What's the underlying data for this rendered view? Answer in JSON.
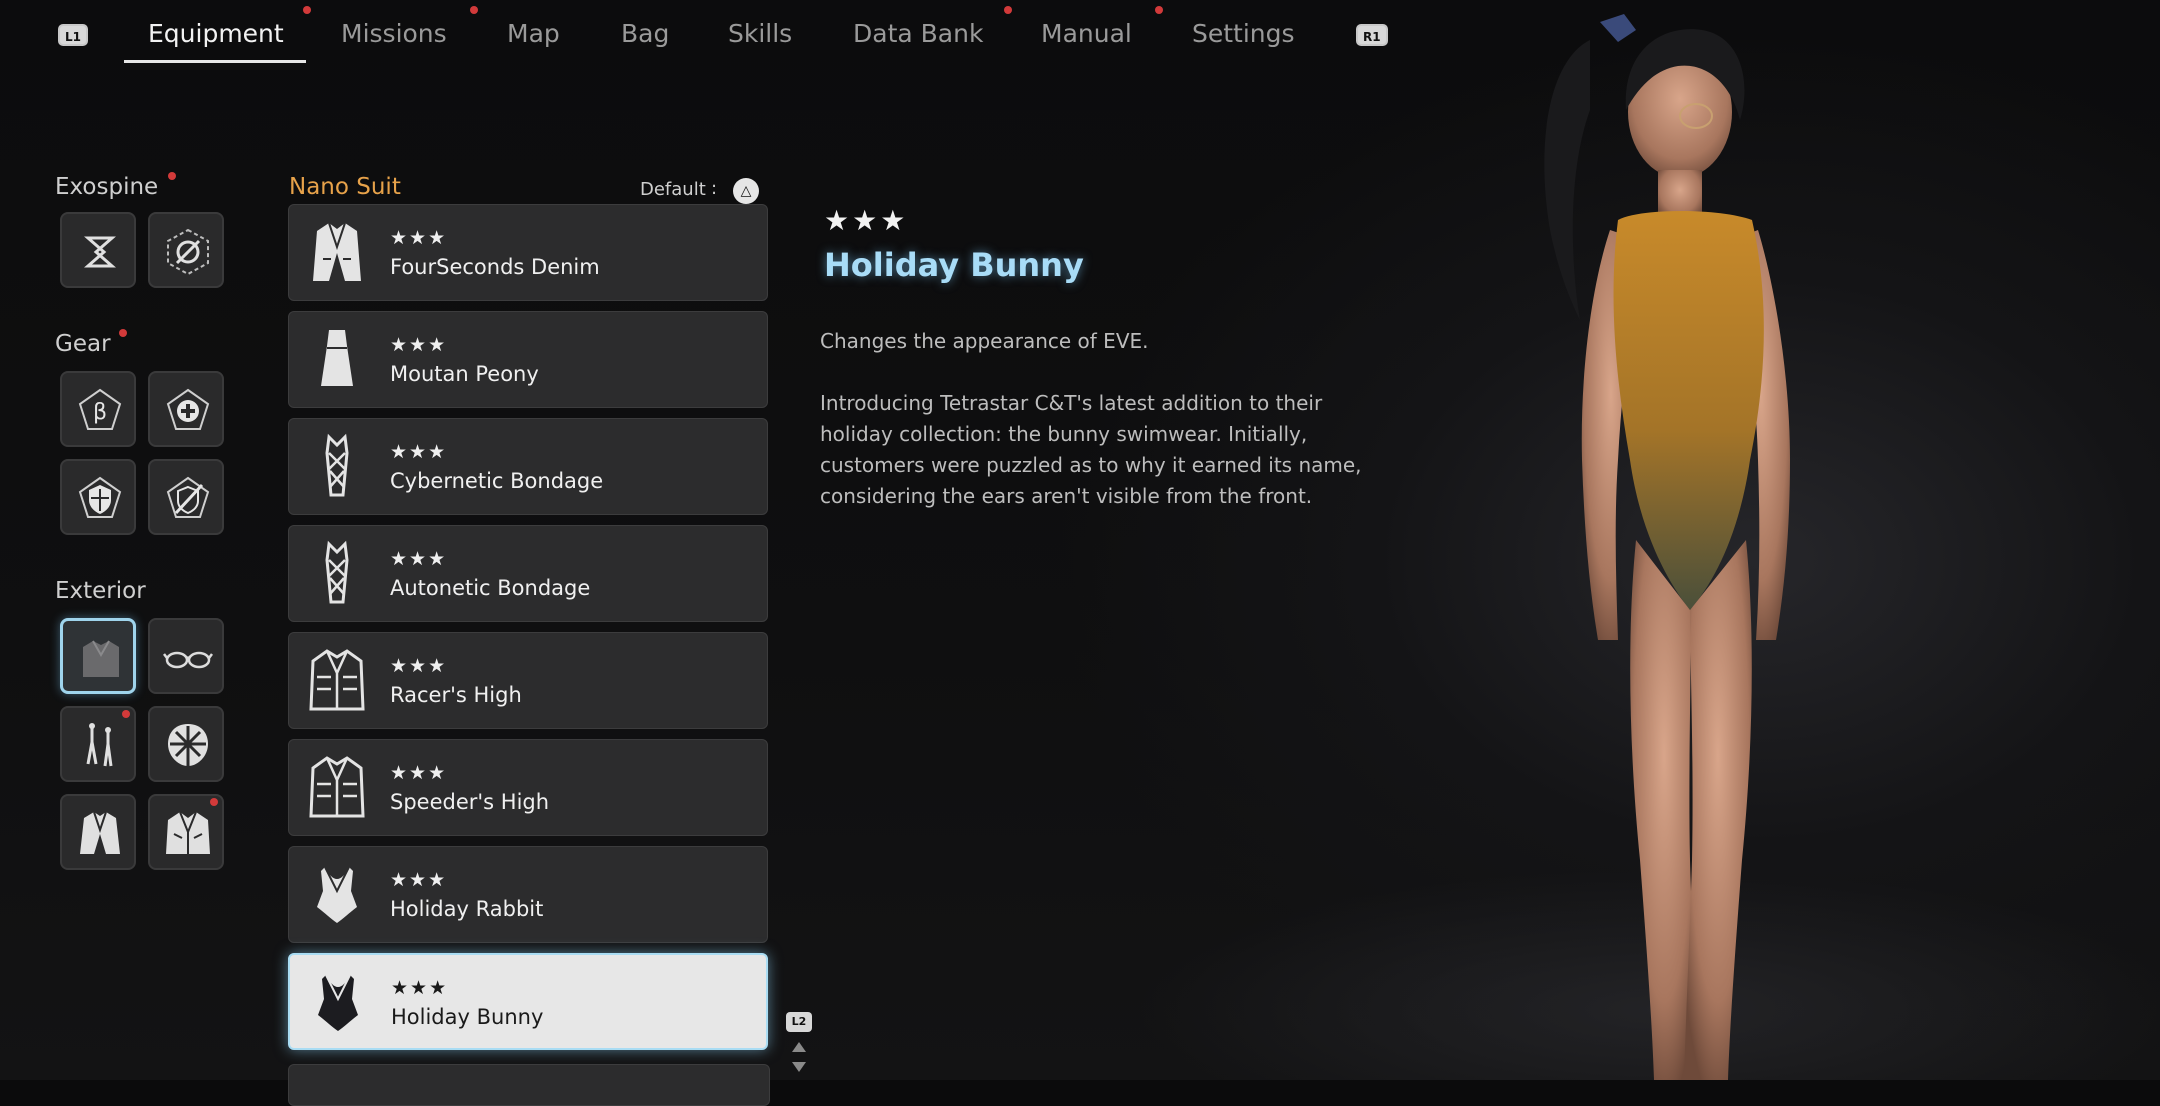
{
  "nav": {
    "left_button": "L1",
    "right_button": "R1",
    "tabs": [
      {
        "label": "Equipment",
        "active": true,
        "notify": true
      },
      {
        "label": "Missions",
        "active": false,
        "notify": true
      },
      {
        "label": "Map",
        "active": false,
        "notify": false
      },
      {
        "label": "Bag",
        "active": false,
        "notify": false
      },
      {
        "label": "Skills",
        "active": false,
        "notify": false
      },
      {
        "label": "Data Bank",
        "active": false,
        "notify": true
      },
      {
        "label": "Manual",
        "active": false,
        "notify": true
      },
      {
        "label": "Settings",
        "active": false,
        "notify": false
      }
    ]
  },
  "categories": {
    "exospine": {
      "label": "Exospine",
      "notify": true,
      "slots": [
        "exospine-a-icon",
        "exospine-b-icon"
      ]
    },
    "gear": {
      "label": "Gear",
      "notify": true,
      "slots": [
        "gear-beta-icon",
        "gear-plus-icon",
        "gear-shield-icon",
        "gear-sword-icon"
      ]
    },
    "exterior": {
      "label": "Exterior",
      "notify": false,
      "slots": [
        "suit-icon",
        "glasses-icon",
        "earrings-icon",
        "hair-icon",
        "jacket-icon",
        "coat-icon"
      ],
      "selected_slot": "suit-icon"
    }
  },
  "list": {
    "title": "Nano Suit",
    "default_label": "Default",
    "default_button": "△",
    "items": [
      {
        "stars": "★★★",
        "name": "FourSeconds Denim",
        "icon": "jacket-icon"
      },
      {
        "stars": "★★★",
        "name": "Moutan Peony",
        "icon": "dress-icon"
      },
      {
        "stars": "★★★",
        "name": "Cybernetic Bondage",
        "icon": "bodysuit-icon"
      },
      {
        "stars": "★★★",
        "name": "Autonetic Bondage",
        "icon": "bodysuit-icon"
      },
      {
        "stars": "★★★",
        "name": "Racer's High",
        "icon": "racer-jacket-icon"
      },
      {
        "stars": "★★★",
        "name": "Speeder's High",
        "icon": "racer-jacket-icon"
      },
      {
        "stars": "★★★",
        "name": "Holiday Rabbit",
        "icon": "swimsuit-icon"
      },
      {
        "stars": "★★★",
        "name": "Holiday Bunny",
        "icon": "swimsuit-icon",
        "selected": true
      }
    ],
    "page_button": "L2"
  },
  "detail": {
    "stars": "★★★",
    "title": "Holiday Bunny",
    "description": "Changes the appearance of EVE.\n\nIntroducing Tetrastar C&T's latest addition to their holiday collection: the bunny swimwear. Initially, customers were puzzled as to why it earned its name, considering the ears aren't visible from the front."
  },
  "colors": {
    "accent_list_title": "#e7a24a",
    "detail_title": "#a8dcf7",
    "selection_glow": "#a9dcf3",
    "notify_dot": "#d23a3a",
    "swimsuit_top": "#c88a2a",
    "swimsuit_bottom": "#4a4f3a"
  }
}
